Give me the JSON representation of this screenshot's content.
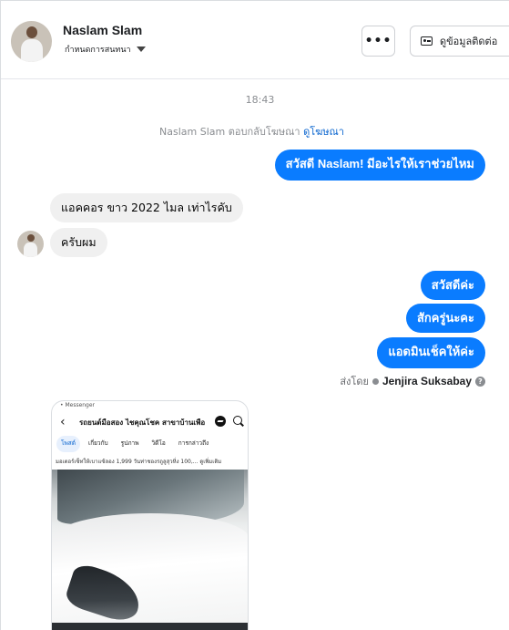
{
  "header": {
    "name": "Naslam Slam",
    "stage": "กำหนดการสนทนา",
    "more_label": "•••",
    "contact_label": "ดูข้อมูลติดต่อ"
  },
  "conversation": {
    "time": "18:43",
    "notice_text": "Naslam Slam ตอบกลับโฆษณา",
    "notice_link": "ดูโฆษณา",
    "messages": [
      {
        "direction": "outgoing",
        "text": "สวัสดี Naslam! มีอะไรให้เราช่วยไหม"
      },
      {
        "direction": "incoming",
        "text": "แอคคอร ขาว 2022 ไมล เท่าไรคับ"
      },
      {
        "direction": "incoming",
        "text": "ครับผม"
      },
      {
        "direction": "outgoing",
        "text": "สวัสดีค่ะ"
      },
      {
        "direction": "outgoing",
        "text": "สักครู่นะคะ"
      },
      {
        "direction": "outgoing",
        "text": "แอดมินเช็คให้ค่ะ"
      }
    ],
    "sent_by_prefix": "ส่งโดย",
    "sent_by_name": "Jenjira Suksabay"
  },
  "attachment": {
    "tiny_label": "• Messenger",
    "title": "รถยนต์มือสอง ไชคุณโชค สาขาบ้านเพือ",
    "tabs": [
      "โพสต์",
      "เกี่ยวกับ",
      "รูปภาพ",
      "วิดีโอ",
      "การกล่าวถึง"
    ],
    "post_text": "มอเตอร์เซ็ทให้เบาแซ้ลอง 1,999 วันท่าชองรถูลูสุวหิ่ง 100,... ดูเพิ่มเติม"
  },
  "colors": {
    "outgoing_bubble": "#0a7cff",
    "incoming_bubble": "#f0f0f0",
    "link": "#0a65cf"
  }
}
